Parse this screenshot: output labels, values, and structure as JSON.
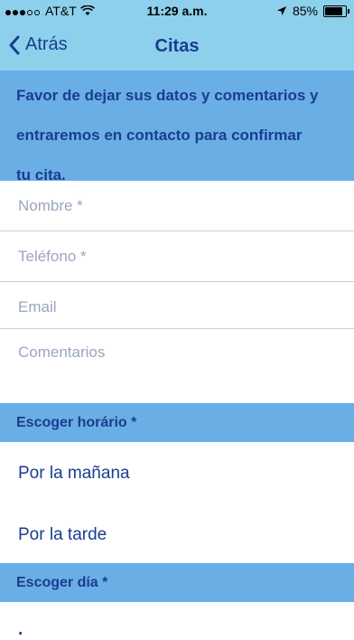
{
  "status_bar": {
    "carrier": "AT&T",
    "time": "11:29 a.m.",
    "battery": "85%",
    "battery_level": 0.85
  },
  "nav": {
    "back_label": "Atrás",
    "title": "Citas"
  },
  "intro": {
    "line1": "Favor de dejar sus datos y comentarios y",
    "line2": "entraremos en contacto para confirmar",
    "line3": "tu cita."
  },
  "form": {
    "nombre_placeholder": "Nombre *",
    "telefono_placeholder": "Teléfono *",
    "email_placeholder": "Email",
    "comentarios_placeholder": "Comentarios"
  },
  "horario": {
    "header": "Escoger horário *",
    "options": [
      "Por la mañana",
      "Por la tarde"
    ]
  },
  "dia": {
    "header": "Escoger día *"
  },
  "colors": {
    "bar": "#8dd0ec",
    "section": "#6aaee6",
    "text": "#1a3d8f",
    "placeholder": "#9aa6bd"
  }
}
